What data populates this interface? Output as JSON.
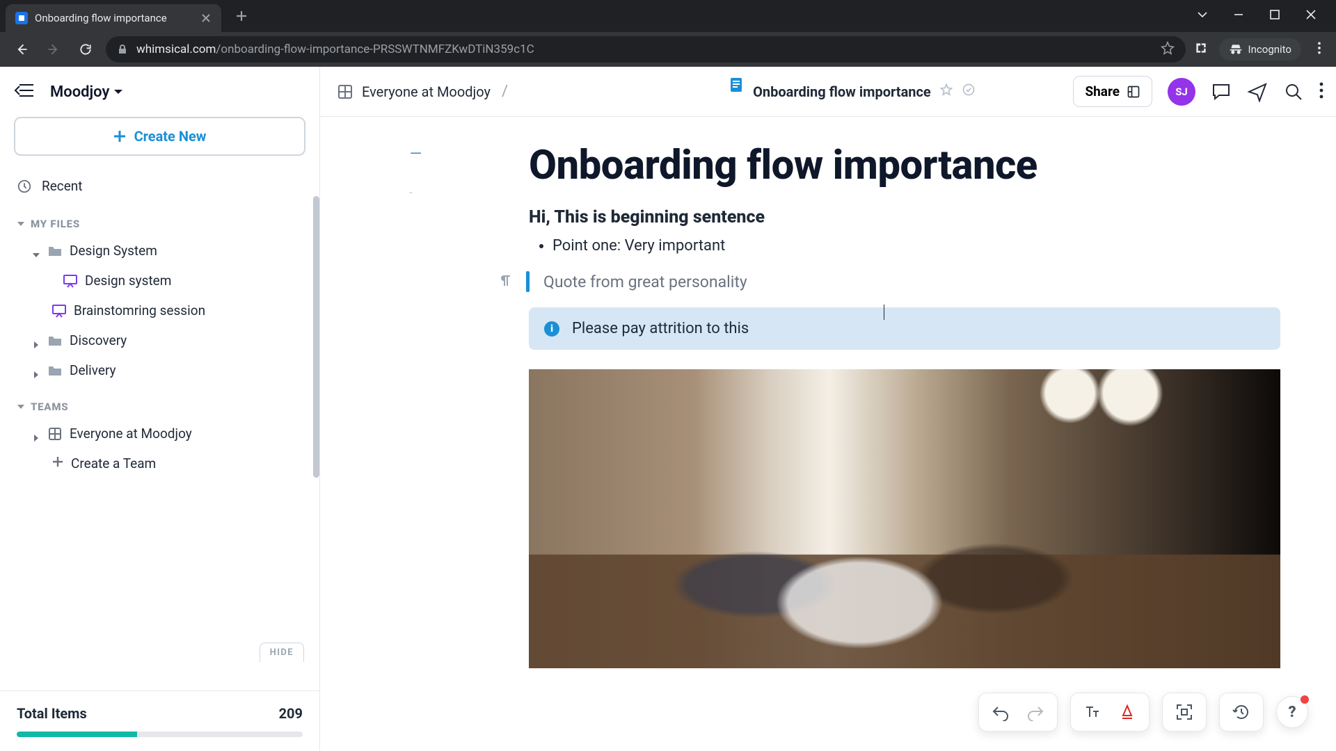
{
  "browser": {
    "tab_title": "Onboarding flow importance",
    "url_domain": "whimsical.com",
    "url_path": "/onboarding-flow-importance-PRSSWTNMFZKwDTiN359c1C",
    "incognito_label": "Incognito"
  },
  "workspace": {
    "name": "Moodjoy"
  },
  "sidebar": {
    "create_label": "Create New",
    "recent_label": "Recent",
    "section_files": "MY FILES",
    "section_teams": "TEAMS",
    "files": {
      "design_system_folder": "Design System",
      "design_system_child": "Design system",
      "brainstorming": "Brainstomring session",
      "discovery": "Discovery",
      "delivery": "Delivery"
    },
    "teams": {
      "everyone": "Everyone at Moodjoy",
      "create_team": "Create a Team"
    },
    "hide_label": "HIDE",
    "footer": {
      "label": "Total Items",
      "count": "209"
    }
  },
  "breadcrumb": {
    "team": "Everyone at Moodjoy",
    "doc": "Onboarding flow importance"
  },
  "topbar": {
    "share_label": "Share",
    "avatar_initials": "SJ"
  },
  "document": {
    "title": "Onboarding flow importance",
    "subheading": "Hi, This is beginning sentence",
    "bullet1": "Point one: Very important",
    "quote": "Quote from great personality",
    "callout": "Please pay attrition to this"
  },
  "help": {
    "label": "?"
  }
}
